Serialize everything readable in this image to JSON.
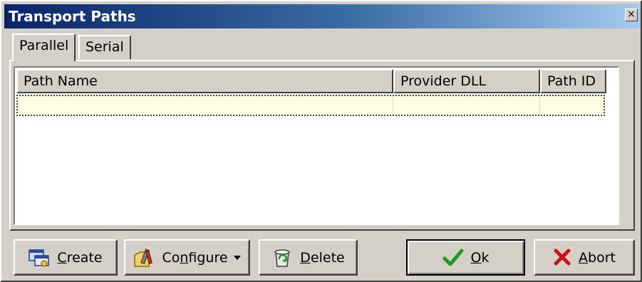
{
  "window": {
    "title": "Transport Paths",
    "close_label": "×"
  },
  "tabs": [
    {
      "label": "Parallel",
      "active": true
    },
    {
      "label": "Serial",
      "active": false
    }
  ],
  "list": {
    "columns": [
      "Path Name",
      "Provider DLL",
      "Path ID"
    ],
    "rows": [
      {
        "path_name": "",
        "provider_dll": "",
        "path_id": ""
      }
    ]
  },
  "buttons": {
    "create": {
      "pre": "",
      "mnemonic": "C",
      "post": "reate",
      "icon": "create-path-icon"
    },
    "configure": {
      "pre": "Co",
      "mnemonic": "n",
      "post": "figure",
      "icon": "configure-tools-icon"
    },
    "delete": {
      "pre": "",
      "mnemonic": "D",
      "post": "elete",
      "icon": "recycle-bin-icon"
    },
    "ok": {
      "pre": "",
      "mnemonic": "O",
      "post": "k",
      "icon": "check-icon"
    },
    "abort": {
      "pre": "",
      "mnemonic": "A",
      "post": "bort",
      "icon": "cross-icon"
    }
  },
  "colors": {
    "title_start": "#0a246a",
    "title_end": "#a6caf0",
    "selected_row": "#fefee4",
    "check_green": "#1e9a1e",
    "abort_red": "#cc1111"
  }
}
